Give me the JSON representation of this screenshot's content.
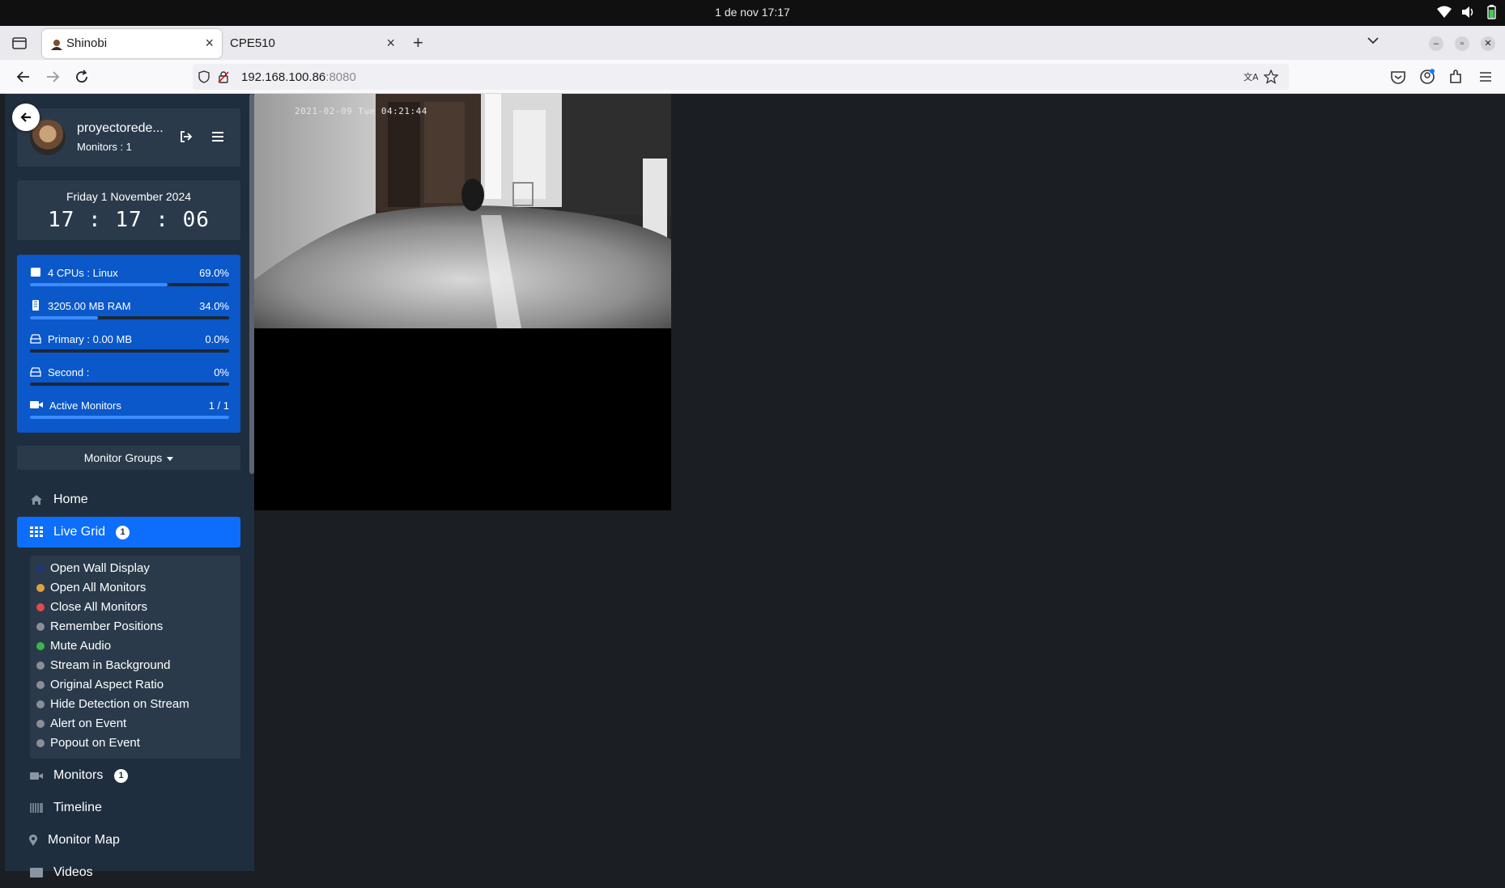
{
  "os": {
    "clock": "1 de nov  17:17",
    "tray_icons": [
      "wifi-icon",
      "volume-icon",
      "battery-icon"
    ]
  },
  "browser": {
    "tabs": [
      {
        "title": "Shinobi",
        "active": true,
        "icon": "shinobi-favicon"
      },
      {
        "title": "CPE510",
        "active": false,
        "icon": null
      }
    ],
    "new_tab_icon": "plus-icon",
    "url_host": "192.168.100.86",
    "url_port": ":8080"
  },
  "sidebar": {
    "user": {
      "name": "proyectorede...",
      "monitors": "Monitors : 1"
    },
    "clock": {
      "date": "Friday 1 November 2024",
      "time": "17 : 17 : 06"
    },
    "stats": [
      {
        "label": "4 CPUs : Linux",
        "value": "69.0%",
        "fraction": 0.69,
        "icon": "cpu-icon"
      },
      {
        "label": "3205.00 MB RAM",
        "value": "34.0%",
        "fraction": 0.34,
        "icon": "ram-icon"
      },
      {
        "label": "Primary : 0.00 MB",
        "value": "0.0%",
        "fraction": 0.0,
        "icon": "disk-icon"
      },
      {
        "label": "Second :",
        "value": "0%",
        "fraction": 0.0,
        "icon": "disk-icon"
      },
      {
        "label": "Active Monitors",
        "value": "1 / 1",
        "fraction": 1.0,
        "icon": "video-camera-icon"
      }
    ],
    "groups_label": "Monitor Groups",
    "nav": {
      "home": "Home",
      "live_grid": "Live Grid",
      "live_grid_badge": "1",
      "monitors": "Monitors",
      "monitors_badge": "1",
      "timeline": "Timeline",
      "monitor_map": "Monitor Map",
      "videos": "Videos"
    },
    "live_grid_options": [
      {
        "label": "Open Wall Display",
        "color": "#1d3a73"
      },
      {
        "label": "Open All Monitors",
        "color": "#e0a040"
      },
      {
        "label": "Close All Monitors",
        "color": "#e04b4b"
      },
      {
        "label": "Remember Positions",
        "color": "#8a8f96"
      },
      {
        "label": "Mute Audio",
        "color": "#39b54a"
      },
      {
        "label": "Stream in Background",
        "color": "#8a8f96"
      },
      {
        "label": "Original Aspect Ratio",
        "color": "#8a8f96"
      },
      {
        "label": "Hide Detection on Stream",
        "color": "#8a8f96"
      },
      {
        "label": "Alert on Event",
        "color": "#8a8f96"
      },
      {
        "label": "Popout on Event",
        "color": "#8a8f96"
      }
    ]
  },
  "main": {
    "camera_timestamp": "2021-02-09 Tue 04:21:44"
  }
}
